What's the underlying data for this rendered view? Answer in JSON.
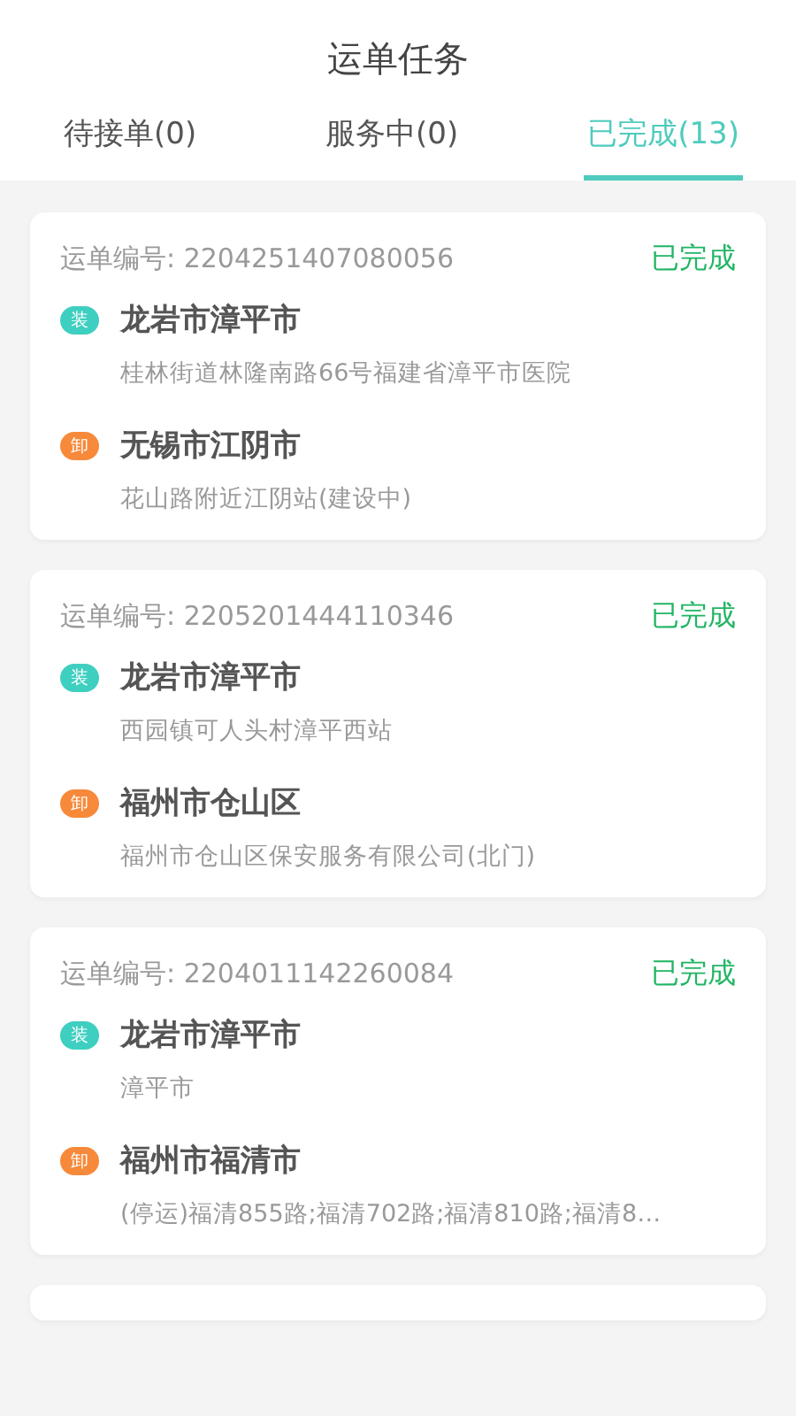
{
  "title": "运单任务",
  "tabs": [
    {
      "label": "待接单(0)",
      "selected": false
    },
    {
      "label": "服务中(0)",
      "selected": false
    },
    {
      "label": "已完成(13)",
      "selected": true
    }
  ],
  "orders": [
    {
      "number_label": "运单编号:",
      "number": "2204251407080056",
      "status": "已完成",
      "stops": [
        {
          "kind": "load",
          "badge": "装",
          "city": "龙岩市漳平市",
          "address": "桂林街道林隆南路66号福建省漳平市医院"
        },
        {
          "kind": "unload",
          "badge": "卸",
          "city": "无锡市江阴市",
          "address": "花山路附近江阴站(建设中)"
        }
      ]
    },
    {
      "number_label": "运单编号:",
      "number": "2205201444110346",
      "status": "已完成",
      "stops": [
        {
          "kind": "load",
          "badge": "装",
          "city": "龙岩市漳平市",
          "address": "西园镇可人头村漳平西站"
        },
        {
          "kind": "unload",
          "badge": "卸",
          "city": "福州市仓山区",
          "address": "福州市仓山区保安服务有限公司(北门)"
        }
      ]
    },
    {
      "number_label": "运单编号:",
      "number": "2204011142260084",
      "status": "已完成",
      "stops": [
        {
          "kind": "load",
          "badge": "装",
          "city": "龙岩市漳平市",
          "address": "漳平市"
        },
        {
          "kind": "unload",
          "badge": "卸",
          "city": "福州市福清市",
          "address": "(停运)福清855路;福清702路;福清810路;福清8…"
        }
      ]
    }
  ]
}
